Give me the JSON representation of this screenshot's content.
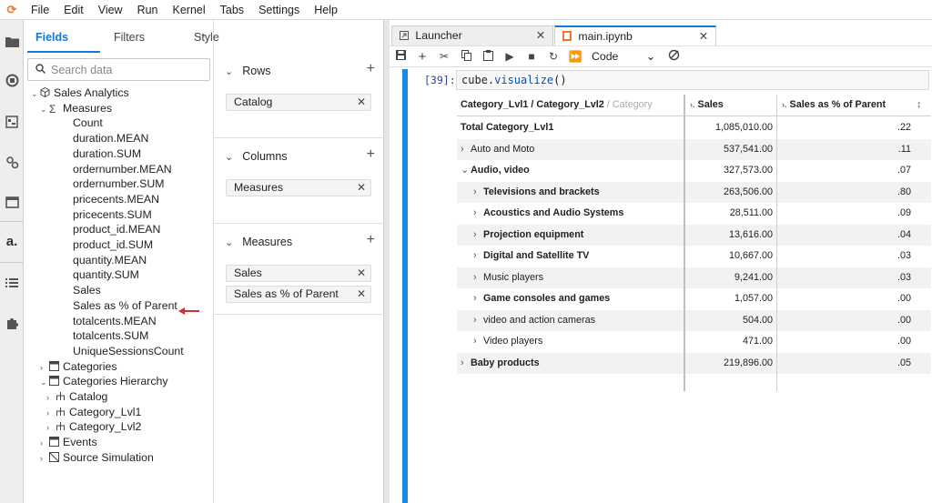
{
  "app": {
    "logo_glyph": "⟳"
  },
  "menu": [
    "File",
    "Edit",
    "View",
    "Run",
    "Kernel",
    "Tabs",
    "Settings",
    "Help"
  ],
  "fields_panel": {
    "tabs": [
      "Fields",
      "Filters",
      "Style"
    ],
    "more": "···",
    "search_placeholder": "Search data",
    "tree": [
      {
        "label": "Sales Analytics",
        "indent": 1,
        "arrow": "▾",
        "icon": "cube"
      },
      {
        "label": "Measures",
        "indent": 2,
        "arrow": "▾",
        "icon": "sigma"
      },
      {
        "label": "Count",
        "indent": 4
      },
      {
        "label": "duration.MEAN",
        "indent": 4
      },
      {
        "label": "duration.SUM",
        "indent": 4
      },
      {
        "label": "ordernumber.MEAN",
        "indent": 4
      },
      {
        "label": "ordernumber.SUM",
        "indent": 4
      },
      {
        "label": "pricecents.MEAN",
        "indent": 4
      },
      {
        "label": "pricecents.SUM",
        "indent": 4
      },
      {
        "label": "product_id.MEAN",
        "indent": 4
      },
      {
        "label": "product_id.SUM",
        "indent": 4
      },
      {
        "label": "quantity.MEAN",
        "indent": 4
      },
      {
        "label": "quantity.SUM",
        "indent": 4
      },
      {
        "label": "Sales",
        "indent": 4
      },
      {
        "label": "Sales as % of Parent",
        "indent": 4
      },
      {
        "label": "totalcents.MEAN",
        "indent": 4
      },
      {
        "label": "totalcents.SUM",
        "indent": 4
      },
      {
        "label": "UniqueSessionsCount",
        "indent": 4
      },
      {
        "label": "Categories",
        "indent": 2,
        "arrow": "›",
        "icon": "table"
      },
      {
        "label": "Categories Hierarchy",
        "indent": 2,
        "arrow": "▾",
        "icon": "table"
      },
      {
        "label": "Catalog",
        "indent": 3,
        "arrow": "›",
        "icon": "hier"
      },
      {
        "label": "Category_Lvl1",
        "indent": 3,
        "arrow": "›",
        "icon": "hier"
      },
      {
        "label": "Category_Lvl2",
        "indent": 3,
        "arrow": "›",
        "icon": "hier"
      },
      {
        "label": "Events",
        "indent": 2,
        "arrow": "›",
        "icon": "table"
      },
      {
        "label": "Source Simulation",
        "indent": 2,
        "arrow": "›",
        "icon": "table2"
      }
    ]
  },
  "config_panel": {
    "sections": [
      {
        "title": "Rows",
        "chips": [
          "Catalog"
        ]
      },
      {
        "title": "Columns",
        "chips": [
          "Measures"
        ]
      },
      {
        "title": "Measures",
        "chips": [
          "Sales",
          "Sales as % of Parent"
        ]
      }
    ]
  },
  "notebook": {
    "tabs": [
      {
        "label": "Launcher",
        "icon": "launcher-icon",
        "active": false
      },
      {
        "label": "main.ipynb",
        "icon": "notebook-icon",
        "active": true
      }
    ],
    "kernel_mode": "Code",
    "prompt": "[39]:",
    "code_obj": "cube.",
    "code_fn": "visualize",
    "code_tail": "()"
  },
  "pivot": {
    "header_row_label": "Category_Lvl1 / Category_Lvl2",
    "header_row_label_faded": "/ Category",
    "col_sales": "Sales",
    "col_pct": "Sales as % of Parent",
    "rows": [
      {
        "label": "Total Category_Lvl1",
        "level": 0,
        "bold": true,
        "arrow": "",
        "sales": "1,085,010.00",
        "pct": ".22"
      },
      {
        "label": "Auto and Moto",
        "level": 0,
        "bold": false,
        "arrow": "›",
        "sales": "537,541.00",
        "pct": ".11"
      },
      {
        "label": "Audio, video",
        "level": 0,
        "bold": true,
        "arrow": "▾",
        "sales": "327,573.00",
        "pct": ".07"
      },
      {
        "label": "Televisions and brackets",
        "level": 1,
        "bold": true,
        "arrow": "›",
        "sales": "263,506.00",
        "pct": ".80"
      },
      {
        "label": "Acoustics and Audio Systems",
        "level": 1,
        "bold": true,
        "arrow": "›",
        "sales": "28,511.00",
        "pct": ".09"
      },
      {
        "label": "Projection equipment",
        "level": 1,
        "bold": true,
        "arrow": "›",
        "sales": "13,616.00",
        "pct": ".04"
      },
      {
        "label": "Digital and Satellite TV",
        "level": 1,
        "bold": true,
        "arrow": "›",
        "sales": "10,667.00",
        "pct": ".03"
      },
      {
        "label": "Music players",
        "level": 1,
        "bold": false,
        "arrow": "›",
        "sales": "9,241.00",
        "pct": ".03"
      },
      {
        "label": "Game consoles and games",
        "level": 1,
        "bold": true,
        "arrow": "›",
        "sales": "1,057.00",
        "pct": ".00"
      },
      {
        "label": "video and action cameras",
        "level": 1,
        "bold": false,
        "arrow": "›",
        "sales": "504.00",
        "pct": ".00"
      },
      {
        "label": "Video players",
        "level": 1,
        "bold": false,
        "arrow": "›",
        "sales": "471.00",
        "pct": ".00"
      },
      {
        "label": "Baby products",
        "level": 0,
        "bold": true,
        "arrow": "›",
        "sales": "219,896.00",
        "pct": ".05"
      }
    ]
  }
}
